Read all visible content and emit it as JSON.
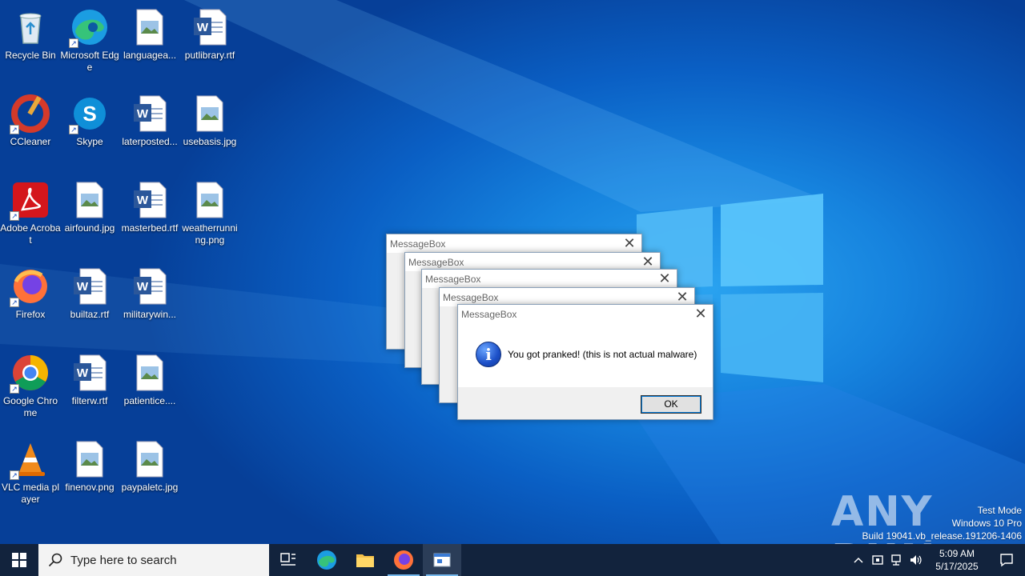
{
  "desktop": {
    "icons": [
      {
        "label": "Recycle Bin"
      },
      {
        "label": "Microsoft Edge"
      },
      {
        "label": "languagea..."
      },
      {
        "label": "putlibrary.rtf"
      },
      {
        "label": "CCleaner"
      },
      {
        "label": "Skype"
      },
      {
        "label": "laterposted..."
      },
      {
        "label": "usebasis.jpg"
      },
      {
        "label": "Adobe Acrobat"
      },
      {
        "label": "airfound.jpg"
      },
      {
        "label": "masterbed.rtf"
      },
      {
        "label": "weatherrunning.png"
      },
      {
        "label": "Firefox"
      },
      {
        "label": "builtaz.rtf"
      },
      {
        "label": "militarywin..."
      },
      {
        "label": "Google Chrome"
      },
      {
        "label": "filterw.rtf"
      },
      {
        "label": "patientice...."
      },
      {
        "label": "VLC media player"
      },
      {
        "label": "finenov.png"
      },
      {
        "label": "paypaletc.jpg"
      }
    ]
  },
  "messageboxes": [
    {
      "title": "MessageBox"
    },
    {
      "title": "MessageBox"
    },
    {
      "title": "MessageBox"
    },
    {
      "title": "MessageBox"
    },
    {
      "title": "MessageBox",
      "message": "You got pranked! (this is not actual malware)",
      "ok_label": "OK"
    }
  ],
  "watermark": {
    "brand": "ANY RUN",
    "line1": "Test Mode",
    "line2": "Windows 10 Pro",
    "line3": "Build 19041.vb_release.191206-1406"
  },
  "taskbar": {
    "search_placeholder": "Type here to search",
    "time": "5:09 AM",
    "date": "5/17/2025"
  },
  "colors": {
    "taskbar": "#12233d",
    "desktop_blue": "#1683de",
    "info_icon": "#1c4fc7"
  }
}
